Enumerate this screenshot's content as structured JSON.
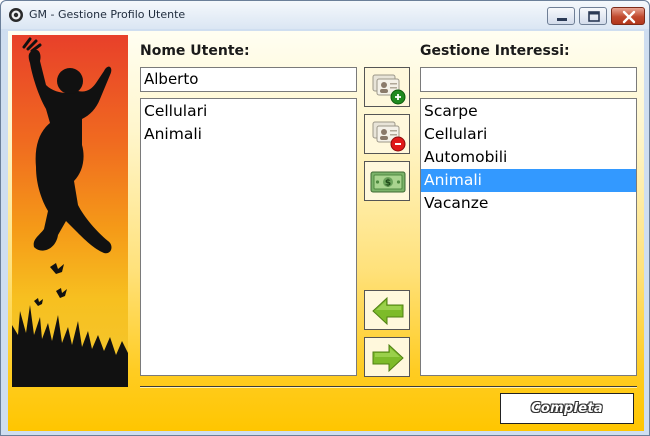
{
  "window": {
    "title": "GM - Gestione Profilo Utente",
    "icon": "gm-app-icon",
    "controls": [
      "minimize-icon",
      "maximize-icon",
      "close-icon"
    ]
  },
  "user": {
    "label": "Nome Utente:",
    "name_value": "Alberto",
    "interests": [
      "Cellulari",
      "Animali"
    ]
  },
  "interests_panel": {
    "label": "Gestione Interessi:",
    "input_value": "",
    "items": [
      "Scarpe",
      "Cellulari",
      "Automobili",
      "Animali",
      "Vacanze"
    ],
    "selected": "Animali"
  },
  "toolbar": {
    "add_user_icon": "add-user-card-icon",
    "remove_user_icon": "remove-user-card-icon",
    "money_icon": "money-banknote-icon",
    "move_left_icon": "green-arrow-left-icon",
    "move_right_icon": "green-arrow-right-icon"
  },
  "actions": {
    "complete_label": "Completa"
  },
  "colors": {
    "selection": "#3399ff",
    "background_top": "#fffef2",
    "background_bottom": "#ffc600",
    "arrow_green": "#7dbb2a"
  }
}
